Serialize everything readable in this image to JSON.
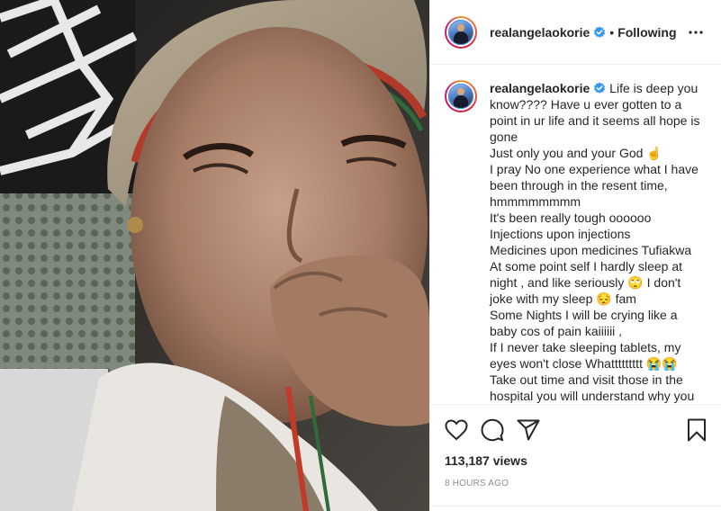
{
  "post": {
    "username": "realangelaokorie",
    "separator": "•",
    "follow_status": "Following",
    "caption_lines": [
      "Life is deep you know???? Have u ever gotten to a point in ur life and it seems all hope is gone",
      "Just only you and your God ☝",
      "I pray No one experience what I have been through in the resent time, hmmmmmmmm",
      "It's been really tough oooooo",
      "Injections upon injections",
      "Medicines upon medicines Tufiakwa",
      "At some point self I hardly sleep at night , and like seriously 🙄 I don't joke with my sleep 😔 fam",
      "Some Nights I will be crying like a baby cos of pain kaiiiiii ,",
      "If I never take sleeping tablets, my eyes won't close Whattttttttt 😭😭",
      "Take out time and visit those in the hospital you will understand why you"
    ],
    "views": "113,187 views",
    "timestamp": "8 HOURS AGO"
  },
  "icons": {
    "verified": "verified-badge-icon",
    "more": "more-options-icon",
    "like": "heart-icon",
    "comment": "comment-icon",
    "share": "share-icon",
    "save": "bookmark-icon"
  },
  "colors": {
    "verified": "#3897f0",
    "text": "#262626",
    "muted": "#8e8e8e",
    "border": "#efefef"
  }
}
